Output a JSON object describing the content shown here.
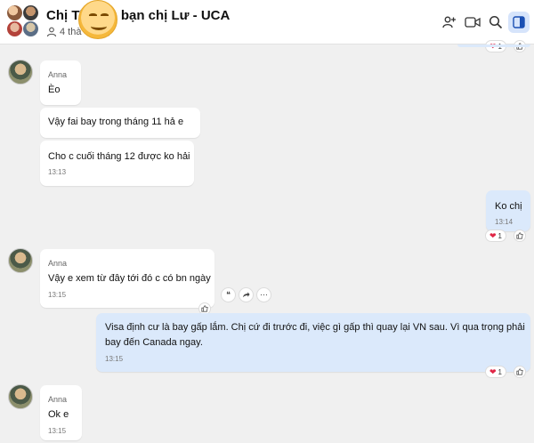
{
  "header": {
    "title": "Chị Th… - bạn chị Lư - UCA",
    "title_visible_left": "Chị Th",
    "title_visible_right": "- bạn chị Lư - UCA",
    "members": "4 thà",
    "icons": [
      "add-person-icon",
      "video-call-icon",
      "search-icon",
      "side-panel-icon"
    ],
    "accent": "#1a73e8"
  },
  "messages": [
    {
      "sender": "Anna",
      "text": "Èo"
    },
    {
      "text": "Vậy fai bay trong tháng 11 hả e"
    },
    {
      "text": "Cho c cuối tháng 12 được ko hải",
      "time": "13:13"
    },
    {
      "text": "Ko chị",
      "time": "13:14",
      "reaction": "1",
      "mine": true
    },
    {
      "sender": "Anna",
      "text": "Vậy e xem từ đây tới đó c có bn ngày",
      "time": "13:15"
    },
    {
      "lines": [
        "Visa định cư là bay gấp lắm. Chị cứ đi trước đi, việc gì gấp thì quay lại VN sau. Vì qua trọng phải",
        "bay đến Canada ngay."
      ],
      "time": "13:15",
      "reaction": "1",
      "mine": true
    },
    {
      "sender": "Anna",
      "text": "Ok e",
      "time": "13:15"
    }
  ],
  "top_reaction": "1",
  "colors": {
    "bg": "#f0f0f0",
    "mine_bubble": "#dbe9fb",
    "heart": "#e02646"
  }
}
